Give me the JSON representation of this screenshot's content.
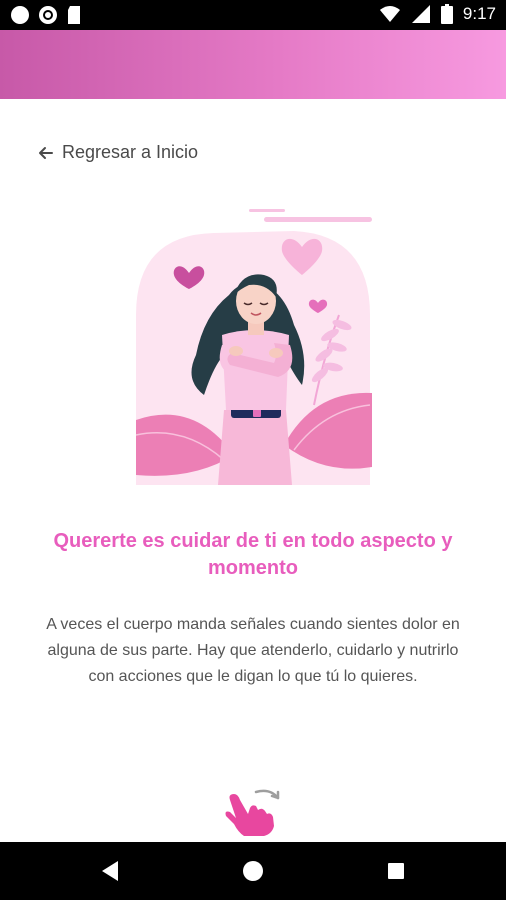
{
  "status_bar": {
    "time": "9:17",
    "left_icons": [
      "circle-icon",
      "record-icon",
      "sd-card-icon"
    ],
    "right_icons": [
      "wifi-icon",
      "signal-icon",
      "battery-icon"
    ]
  },
  "app_bar": {
    "gradient_start": "#c759a8",
    "gradient_end": "#f79ae0"
  },
  "back_link": {
    "icon": "arrow-left-icon",
    "label": "Regresar a Inicio"
  },
  "content": {
    "title": "Quererte es cuidar de ti en todo aspecto y momento",
    "description": "A veces el cuerpo manda señales cuando sientes dolor en alguna de sus parte. Hay que atenderlo, cuidarlo y nutrirlo con acciones que le digan lo que tú lo quieres.",
    "accent_color": "#e85dbd",
    "illustration": "woman-hugging-herself-illustration",
    "swipe_hint_icon": "swipe-hand-icon"
  },
  "nav_bar": {
    "buttons": [
      "back-triangle-icon",
      "home-circle-icon",
      "recents-square-icon"
    ]
  }
}
